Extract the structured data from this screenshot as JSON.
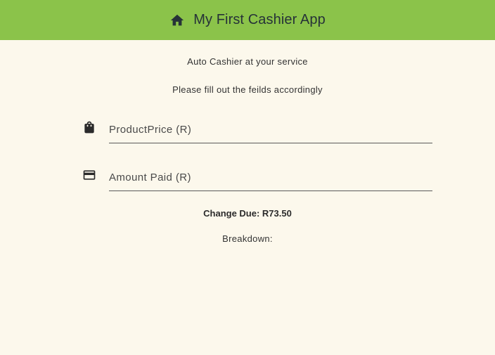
{
  "appbar": {
    "title": "My First Cashier App",
    "icon": "home-icon",
    "color": "#8bc34a"
  },
  "main": {
    "subtitle": "Auto Cashier at your service",
    "instructions": "Please fill out the feilds accordingly",
    "fields": {
      "product_price": {
        "placeholder": "ProductPrice (R)",
        "value": "",
        "icon": "shopping-bag-icon"
      },
      "amount_paid": {
        "placeholder": "Amount Paid (R)",
        "value": "",
        "icon": "credit-card-icon"
      }
    },
    "change_due": "Change Due: R73.50",
    "breakdown_label": "Breakdown:"
  },
  "colors": {
    "background": "#fcf8ec",
    "accent": "#8bc34a"
  }
}
